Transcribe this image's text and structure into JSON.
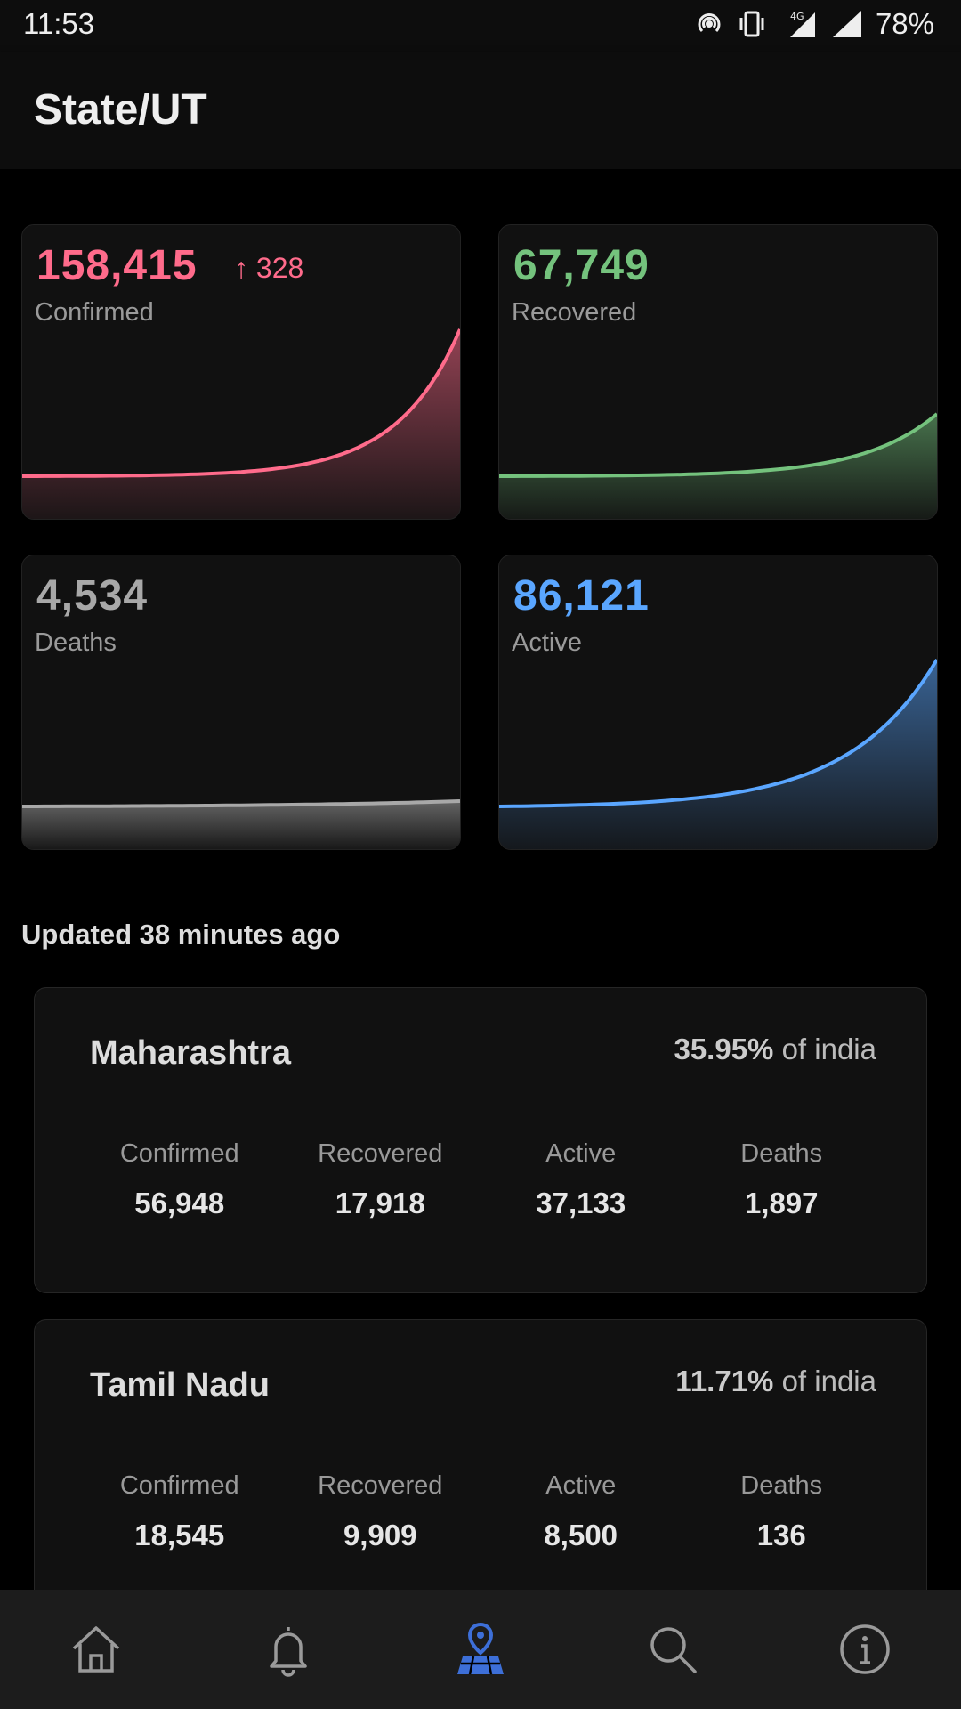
{
  "status_bar": {
    "time": "11:53",
    "battery": "78%"
  },
  "header": {
    "title": "State/UT"
  },
  "stats": [
    {
      "label": "Confirmed",
      "value": "158,415",
      "delta": "↑ 328",
      "color": "#ff6b8b"
    },
    {
      "label": "Recovered",
      "value": "67,749",
      "color": "#74c27d"
    },
    {
      "label": "Deaths",
      "value": "4,534",
      "color": "#a8a8a8"
    },
    {
      "label": "Active",
      "value": "86,121",
      "color": "#5aa6ff"
    }
  ],
  "updated_text": "Updated 38 minutes ago",
  "states": [
    {
      "name": "Maharashtra",
      "pct_value": "35.95%",
      "pct_suffix": "of india",
      "cols": [
        {
          "label": "Confirmed",
          "value": "56,948"
        },
        {
          "label": "Recovered",
          "value": "17,918"
        },
        {
          "label": "Active",
          "value": "37,133"
        },
        {
          "label": "Deaths",
          "value": "1,897"
        }
      ]
    },
    {
      "name": "Tamil Nadu",
      "pct_value": "11.71%",
      "pct_suffix": "of india",
      "cols": [
        {
          "label": "Confirmed",
          "value": "18,545"
        },
        {
          "label": "Recovered",
          "value": "9,909"
        },
        {
          "label": "Active",
          "value": "8,500"
        },
        {
          "label": "Deaths",
          "value": "136"
        }
      ]
    }
  ],
  "nav": [
    {
      "icon": "home-icon"
    },
    {
      "icon": "bell-icon"
    },
    {
      "icon": "map-pin-icon",
      "active": true,
      "active_color": "#3d6fd8"
    },
    {
      "icon": "search-icon"
    },
    {
      "icon": "info-icon"
    }
  ]
}
